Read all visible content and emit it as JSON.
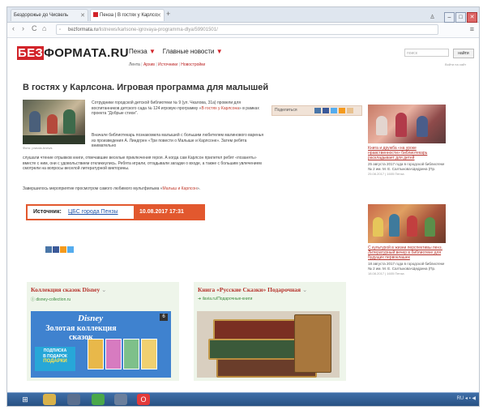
{
  "browser": {
    "tabs": [
      {
        "label": "Бездорожье до Чисвель",
        "active": false
      },
      {
        "label": "Пенза | В гостях у Карлсо",
        "active": true
      }
    ],
    "new_tab": "+",
    "url_domain": "bezformata.ru",
    "url_path": "/listnews/karlsone-igrovaya-programma-dlya/59901501/",
    "nav": {
      "back": "‹",
      "forward": "›",
      "reload": "C",
      "home": "⌂",
      "menu": "≡"
    },
    "win_buttons": {
      "min": "–",
      "max": "□",
      "close": "✕"
    }
  },
  "site": {
    "logo_prefix": "БЕЗ",
    "logo_rest": "ФОРМАТА.RU",
    "city": "Пенза",
    "main_news": "Главные новости",
    "subnav": [
      "Лента",
      "Архив",
      "Источники",
      "Новостройки"
    ],
    "search_placeholder": "поиск",
    "search_button": "найти",
    "top_right": "Войти на сайт"
  },
  "article": {
    "title": "В гостях у Карлсона. Игровая программа для малышей",
    "photo_caption": "Фото: pravda-bnews",
    "p1_text": "Сотрудники городской детской библиотеки № 9 (ул. Чкалова, 31а) провели для воспитанников детского сада № 124 игровую программу «",
    "p1_link": "В гостях у Карлсона",
    "p1_text2": "» в рамках проекта \"Добрые стихи\".",
    "p2_text": "Вначале библиотекарь познакомила малышей с большим любителем малинового варенья из произведения А. Линдгрен «Три повести о Малыше и Карлсоне». Затем ребята внимательно",
    "p3_text": "слушали чтение отрывков книги, отвечавшие веселые приключения героя. А когда сам Карлсон прилетел ребят «позанять» вместе с ним, они с удовольствием откликнулись. Ребята играли, отгадывали загадки о входе, а также с большим увлечением смотрели на вопросы веселой литературной викторины.",
    "p4_text": "Завершилось мероприятие просмотром самого любимого мультфильма «",
    "p4_link": "Малыш и Карлсон",
    "p4_text2": "».",
    "share_label": "Поделиться",
    "source_label": "Источник:",
    "source_link": "ЦБС города Пензы",
    "source_date": "10.08.2017   17:31"
  },
  "ads": [
    {
      "title": "Коллекция сказок Disney",
      "sub": "Ⓘ disney-collection.ru",
      "brand": "Disney",
      "collection": "Золотая коллекция сказок",
      "promo_line1": "ПОДПИСКА",
      "promo_line2": "В ПОДАРОК",
      "promo_line3": "ПОДАРКИ",
      "num": "6"
    },
    {
      "title": "Книга «Русские Сказки» Подарочная",
      "sub": "➜ ilavia.ru/Подарочные-книги"
    }
  ],
  "sidebar": [
    {
      "link": "Книга и дружба «на уроке нравственности» библиотекарь раскладывает для детей",
      "text": "25 августа 2017 года в городской библиотеке № 2 им. М. Е. Салтыкова-Щедрина (Пр.",
      "meta": "25.08.2017 | 1605 Пенза"
    },
    {
      "link": "С культурой в жизни перспективы пенз. Литературный вечер в библиотеке для будущих первоклашек",
      "text": "18 августа 2017 года в городской библиотеке № 2 им. М. Е. Салтыкова-Щедрина (Пр.",
      "meta": "18.08.2017 | 1605 Пенза"
    }
  ],
  "taskbar": {
    "start": "⊞",
    "tray": "RU  ◂  ▪  ◀"
  },
  "colors": {
    "brand_red": "#d2242a",
    "source_orange": "#e2582e",
    "link_red": "#c0392b",
    "ad_bg": "#eef5ea"
  }
}
